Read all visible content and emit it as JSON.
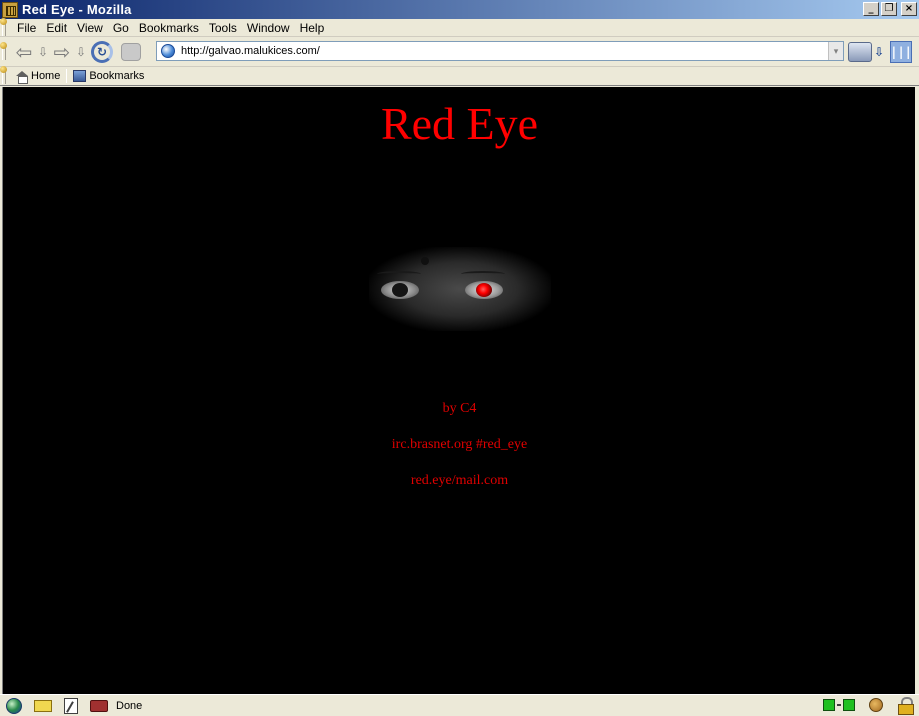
{
  "window": {
    "title": "Red Eye - Mozilla",
    "minimize_glyph": "_",
    "maximize_glyph": "❐",
    "close_glyph": "×"
  },
  "menu": [
    {
      "label": "File",
      "key": "F"
    },
    {
      "label": "Edit",
      "key": "E"
    },
    {
      "label": "View",
      "key": "V"
    },
    {
      "label": "Go",
      "key": "G"
    },
    {
      "label": "Bookmarks",
      "key": "B"
    },
    {
      "label": "Tools",
      "key": "T"
    },
    {
      "label": "Window",
      "key": "W"
    },
    {
      "label": "Help",
      "key": "H"
    }
  ],
  "nav": {
    "back_glyph": "⇦",
    "forward_glyph": "⇨",
    "small_down_glyph": "⇩",
    "reload_glyph": "↻",
    "url": "http://galvao.malukices.com/",
    "dropdown_glyph": "▾",
    "print_down_glyph": "⇩",
    "throbber_glyph": "|||"
  },
  "personal_toolbar": {
    "home_label": "Home",
    "bookmarks_label": "Bookmarks"
  },
  "page": {
    "title": "Red Eye",
    "credit_author": "by C4",
    "credit_irc": "irc.brasnet.org #red_eye",
    "credit_mail": "red.eye/mail.com"
  },
  "status": {
    "text": "Done"
  },
  "colors": {
    "page_background": "#000000",
    "title_red": "#ff0000",
    "credit_red": "#e00000",
    "titlebar_start": "#0a246a",
    "titlebar_end": "#a6caf0"
  },
  "icons": {
    "statusbar_left": [
      "navigator-icon",
      "mail-icon",
      "composer-icon",
      "address-book-icon"
    ],
    "statusbar_right": [
      "online-status-icon",
      "cookie-icon",
      "security-lock-icon"
    ]
  }
}
